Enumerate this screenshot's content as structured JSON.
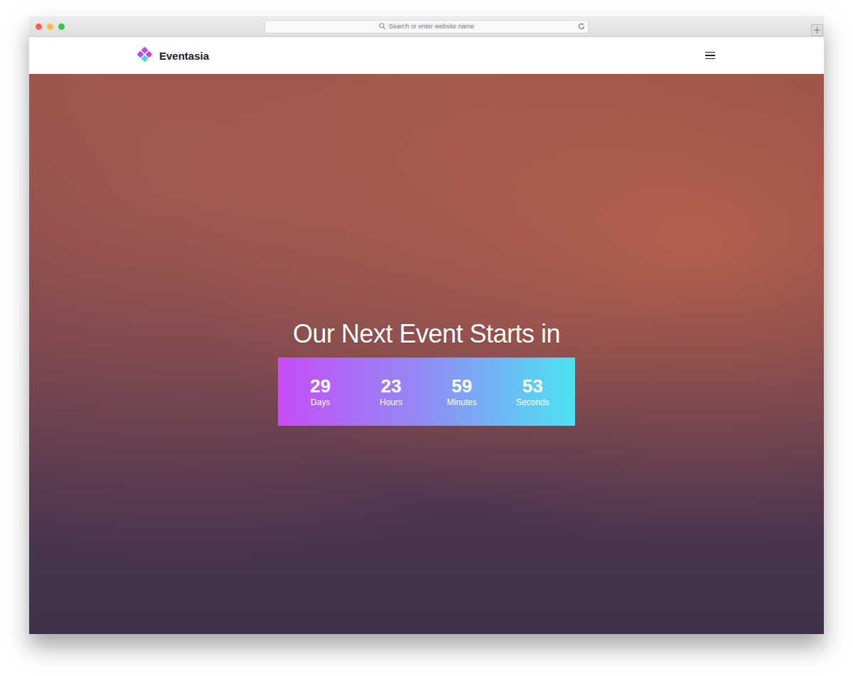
{
  "browser": {
    "address_placeholder": "Search or enter website name"
  },
  "site": {
    "logo": "Eventasia"
  },
  "hero": {
    "title": "Our Next Event Starts in",
    "countdown": [
      {
        "value": "29",
        "unit": "Days"
      },
      {
        "value": "23",
        "unit": "Hours"
      },
      {
        "value": "59",
        "unit": "Minutes"
      },
      {
        "value": "53",
        "unit": "Seconds"
      }
    ]
  }
}
